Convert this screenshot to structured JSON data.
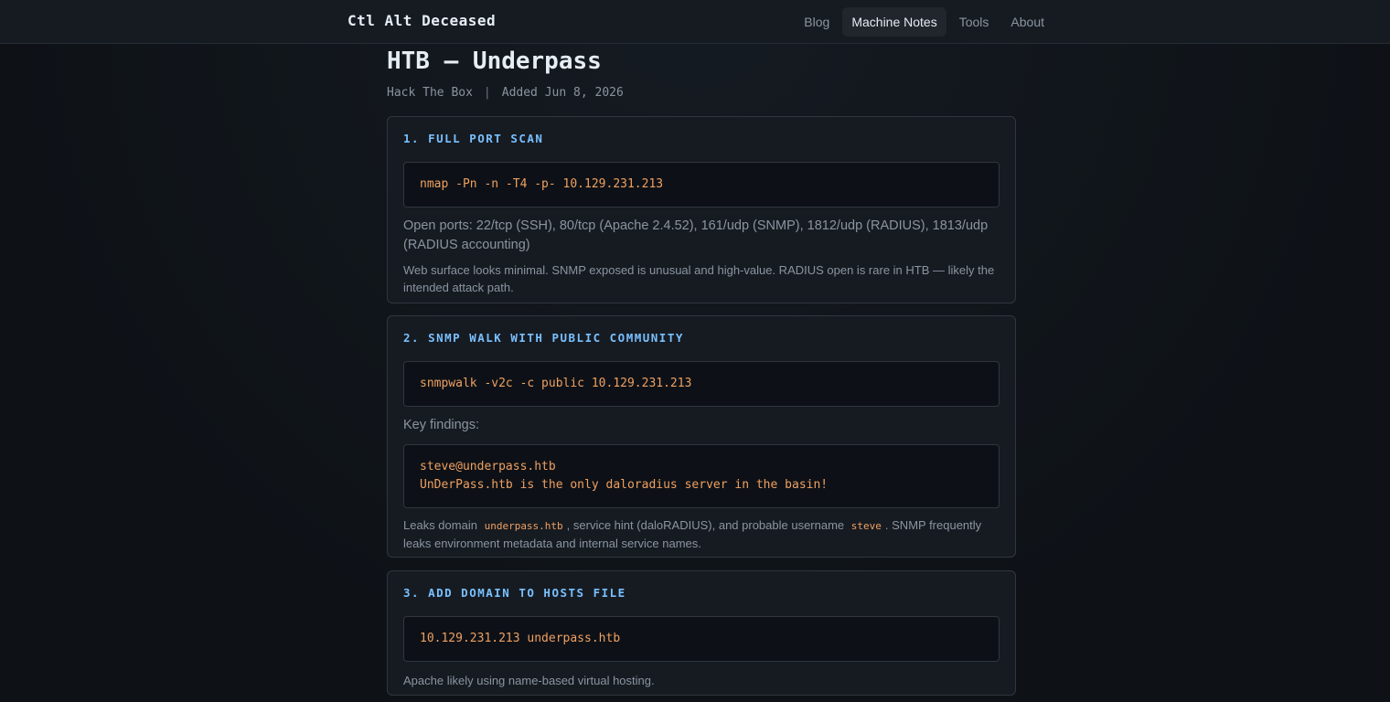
{
  "brand": "Ctl Alt Deceased",
  "nav": [
    "Blog",
    "Machine Notes",
    "Tools",
    "About"
  ],
  "page": {
    "title": "HTB — Underpass",
    "category": "Hack The Box",
    "separator": "|",
    "added": "Added Jun 8, 2026"
  },
  "steps": [
    {
      "title": "1. FULL PORT SCAN",
      "code": [
        "nmap -Pn -n -T4 -p- 10.129.231.213"
      ],
      "text": "Open ports: 22/tcp (SSH), 80/tcp (Apache 2.4.52), 161/udp (SNMP), 1812/udp (RADIUS), 1813/udp (RADIUS accounting)",
      "note": "Web surface looks minimal. SNMP exposed is unusual and high-value. RADIUS open is rare in HTB — likely the intended attack path."
    },
    {
      "title": "2. SNMP WALK WITH PUBLIC COMMUNITY",
      "code": [
        "snmpwalk -v2c -c public 10.129.231.213"
      ],
      "text": "Key findings:",
      "findings": [
        "steve@underpass.htb",
        "UnDerPass.htb is the only daloradius server in the basin!"
      ],
      "note_parts": {
        "a": "Leaks domain",
        "code1": "underpass.htb",
        "b": ", service hint (daloRADIUS), and probable username",
        "code2": "steve",
        "c": ". SNMP frequently leaks environment metadata and internal service names."
      }
    },
    {
      "title": "3. ADD DOMAIN TO HOSTS FILE",
      "code": [
        "10.129.231.213 underpass.htb"
      ],
      "note": "Apache likely using name-based virtual hosting."
    }
  ],
  "colors": {
    "accent": "#79c0ff",
    "code_text": "#f0a060",
    "background": "#0f1419",
    "card": "#161b22"
  }
}
